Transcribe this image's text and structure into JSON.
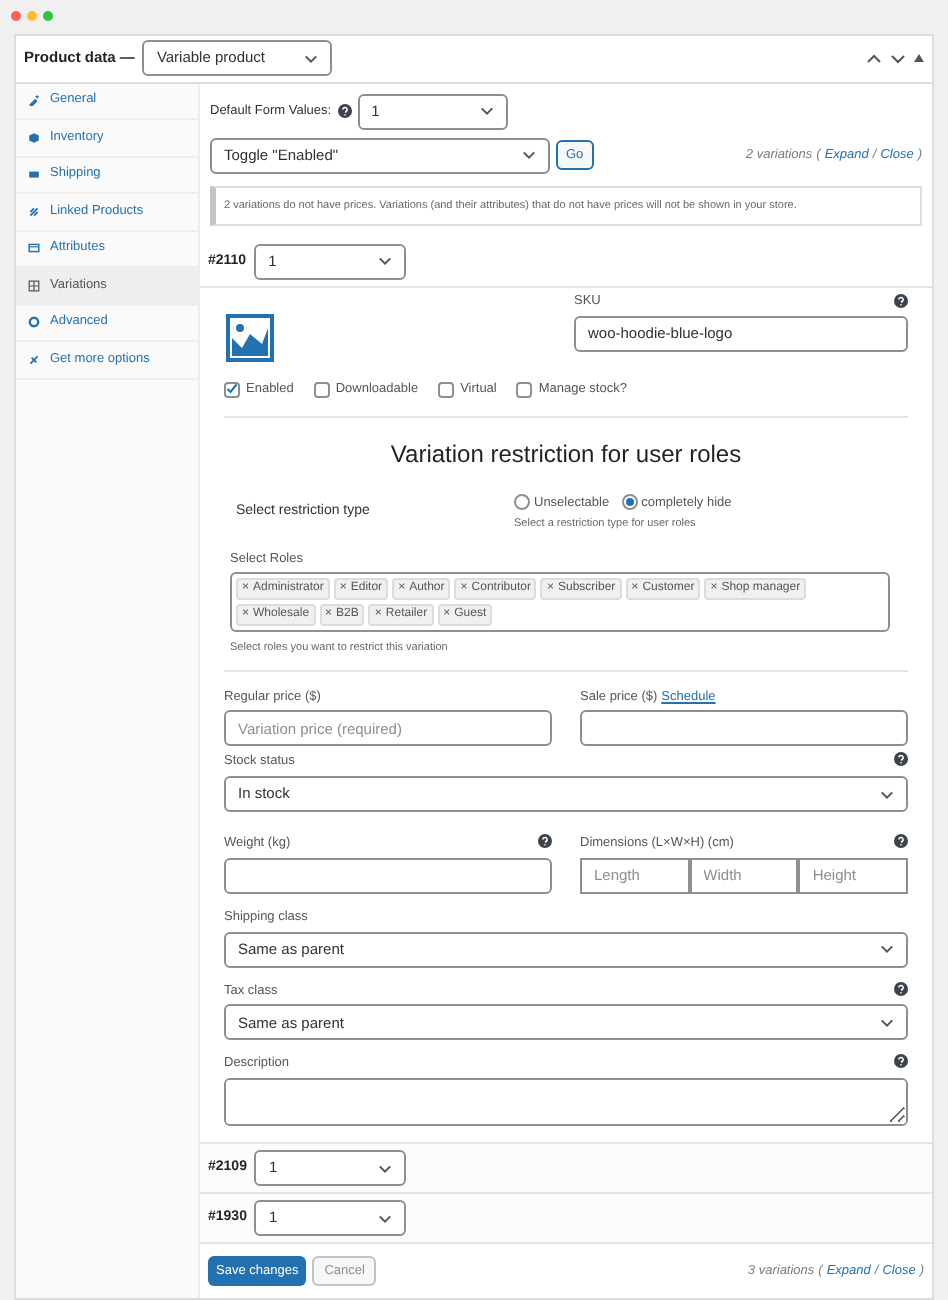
{
  "header": {
    "title": "Product data —",
    "product_type": "Variable product"
  },
  "sidebar": {
    "items": [
      {
        "label": "General",
        "selected": false
      },
      {
        "label": "Inventory",
        "selected": false
      },
      {
        "label": "Shipping",
        "selected": false
      },
      {
        "label": "Linked Products",
        "selected": false
      },
      {
        "label": "Attributes",
        "selected": false
      },
      {
        "label": "Variations",
        "selected": true
      },
      {
        "label": "Advanced",
        "selected": false
      },
      {
        "label": "Get more options",
        "selected": false
      }
    ]
  },
  "default_form_values": {
    "label": "Default Form Values:",
    "value": "1"
  },
  "bulk_action": {
    "value": "Toggle \"Enabled\"",
    "button": "Go"
  },
  "top_summary": {
    "count": "2 variations",
    "open": "(",
    "expand": "Expand",
    "separator": "/",
    "close": "Close",
    "end": ")"
  },
  "notice": "2 variations do not have prices. Variations (and their attributes) that do not have prices will not be shown in your store.",
  "variations": [
    {
      "number": "#2110",
      "value": "1",
      "expanded": true
    },
    {
      "number": "#2109",
      "value": "1",
      "expanded": false
    },
    {
      "number": "#1930",
      "value": "1",
      "expanded": false
    }
  ],
  "details": {
    "sku_label": "SKU",
    "sku": "woo-hoodie-blue-logo",
    "checkboxes": [
      {
        "label": "Enabled",
        "checked": true
      },
      {
        "label": "Downloadable",
        "checked": false
      },
      {
        "label": "Virtual",
        "checked": false
      },
      {
        "label": "Manage stock?",
        "checked": false
      }
    ],
    "restriction": {
      "title": "Variation restriction for user roles",
      "type_label": "Select restriction type",
      "options": [
        {
          "label": "Unselectable",
          "selected": false
        },
        {
          "label": "completely hide",
          "selected": true
        }
      ],
      "type_hint": "Select a restriction type for user roles",
      "roles_label": "Select Roles",
      "roles": [
        "Administrator",
        "Editor",
        "Author",
        "Contributor",
        "Subscriber",
        "Customer",
        "Shop manager",
        "Wholesale",
        "B2B",
        "Retailer",
        "Guest"
      ],
      "remove": "×",
      "roles_hint": "Select roles you want to restrict this variation"
    },
    "regular_price_label": "Regular price ($)",
    "regular_price_placeholder": "Variation price (required)",
    "sale_price_label": "Sale price ($)",
    "schedule_link": "Schedule",
    "stock_status_label": "Stock status",
    "stock_status": "In stock",
    "weight_label": "Weight (kg)",
    "dimensions_label": "Dimensions (L×W×H) (cm)",
    "dimension_placeholders": [
      "Length",
      "Width",
      "Height"
    ],
    "shipping_class_label": "Shipping class",
    "shipping_class": "Same as parent",
    "tax_class_label": "Tax class",
    "tax_class": "Same as parent",
    "description_label": "Description"
  },
  "footer": {
    "save": "Save changes",
    "cancel": "Cancel",
    "summary": {
      "count": "3 variations",
      "open": "(",
      "expand": "Expand",
      "separator": "/",
      "close": "Close",
      "end": ")"
    }
  }
}
